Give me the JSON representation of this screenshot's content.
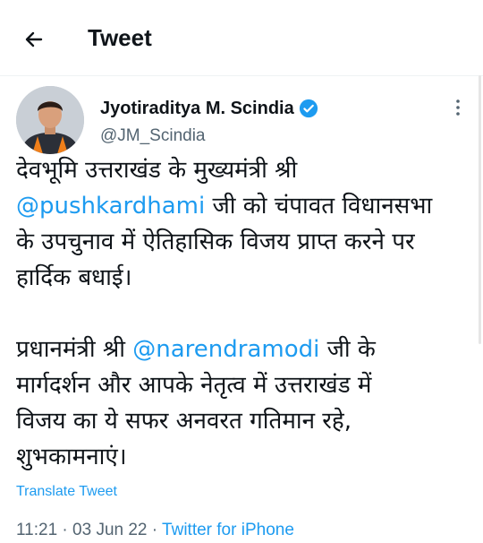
{
  "header": {
    "title": "Tweet"
  },
  "tweet": {
    "author_name": "Jyotiraditya M. Scindia",
    "author_handle": "@JM_Scindia",
    "p1": [
      {
        "text": "देवभूमि उत्तराखंड के मुख्यमंत्री श्री"
      },
      {
        "mention": "@pushkardhami",
        "text": " जी को चंपावत विधानसभा"
      },
      {
        "text": "के उपचुनाव में ऐतिहासिक विजय प्राप्त करने पर"
      },
      {
        "text": "हार्दिक बधाई।"
      }
    ],
    "p2": [
      {
        "text": "प्रधानमंत्री श्री ",
        "mention": "@narendramodi",
        "after": " जी के"
      },
      {
        "text": "मार्गदर्शन और आपके नेतृत्व में उत्तराखंड में"
      },
      {
        "text": "विजय का ये सफर अनवरत गतिमान रहे,"
      },
      {
        "text": "शुभकामनाएं।"
      }
    ],
    "translate_label": "Translate Tweet",
    "time": "11:21",
    "date": "03 Jun 22",
    "separator": "·",
    "source": "Twitter for iPhone"
  },
  "colors": {
    "accent": "#1d9bf0",
    "text": "#0f1419",
    "muted": "#536471"
  },
  "icons": {
    "back": "arrow-left-icon",
    "verified": "verified-badge-icon",
    "more": "more-vertical-icon"
  }
}
